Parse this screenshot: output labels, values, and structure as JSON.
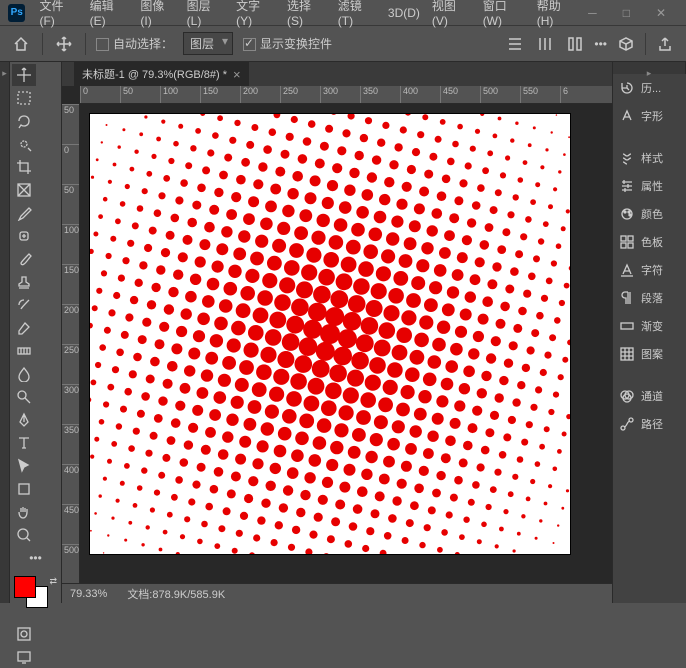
{
  "menu": {
    "file": "文件(F)",
    "edit": "编辑(E)",
    "image": "图像(I)",
    "layer": "图层(L)",
    "type": "文字(Y)",
    "select": "选择(S)",
    "filter": "滤镜(T)",
    "threeD": "3D(D)",
    "view": "视图(V)",
    "window": "窗口(W)",
    "help": "帮助(H)"
  },
  "options": {
    "autoSelect": "自动选择：",
    "target": "图层",
    "showTransform": "显示变换控件"
  },
  "tab": {
    "title": "未标题-1 @ 79.3%(RGB/8#) *"
  },
  "rulerH": [
    "0",
    "50",
    "100",
    "150",
    "200",
    "250",
    "300",
    "350",
    "400",
    "450",
    "500",
    "550",
    "6"
  ],
  "rulerV": [
    "50",
    "0",
    "50",
    "100",
    "150",
    "200",
    "250",
    "300",
    "350",
    "400",
    "450",
    "500"
  ],
  "status": {
    "zoom": "79.33%",
    "docLabel": "文档:",
    "docSize": "878.9K/585.9K"
  },
  "colors": {
    "fg": "#ff0000",
    "bg": "#ffffff"
  },
  "panels": {
    "history": "历...",
    "glyphs": "字形",
    "styles": "样式",
    "properties": "属性",
    "color": "颜色",
    "swatches": "色板",
    "character": "字符",
    "paragraph": "段落",
    "gradient": "渐变",
    "patterns": "图案",
    "channels": "通道",
    "paths": "路径"
  }
}
